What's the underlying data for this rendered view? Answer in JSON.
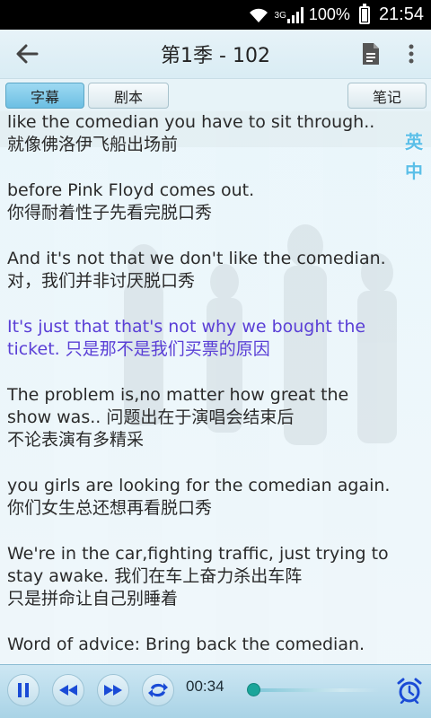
{
  "status_bar": {
    "network": "3G",
    "battery_text": "100%",
    "time": "21:54"
  },
  "header": {
    "title": "第1季 - 102",
    "back_icon": "arrow-left-icon",
    "doc_icon": "document-icon",
    "menu_icon": "overflow-menu-icon"
  },
  "tabs": [
    {
      "label": "字幕",
      "active": true
    },
    {
      "label": "剧本",
      "active": false
    },
    {
      "label": "笔记",
      "active": false
    }
  ],
  "lang_toggle": [
    "英",
    "中"
  ],
  "subtitles": [
    {
      "en": "like the comedian you have to sit through..",
      "zh": "就像佛洛伊飞船出场前",
      "current": false
    },
    {
      "en": "before Pink Floyd comes out.",
      "zh": "你得耐着性子先看完脱口秀",
      "current": false
    },
    {
      "en": "And it's not that we don't like the comedian.",
      "zh": "对，我们并非讨厌脱口秀",
      "current": false
    },
    {
      "en": "It's just that that's not why we bought the ticket.",
      "zh": "只是那不是我们买票的原因",
      "current": true
    },
    {
      "en": "The problem is,no matter how great the show was..",
      "zh": "问题出在于演唱会结束后\n不论表演有多精采",
      "current": false
    },
    {
      "en": "you girls are looking for the comedian again.",
      "zh": "你们女生总还想再看脱口秀",
      "current": false
    },
    {
      "en": "We're in the car,fighting traffic, just trying to stay awake.",
      "zh": "我们在车上奋力杀出车阵\n只是拼命让自己别睡着",
      "current": false
    },
    {
      "en": "Word of advice: Bring back the comedian.",
      "zh": "",
      "current": false
    }
  ],
  "player": {
    "time": "00:34",
    "progress": 0.05,
    "colors": {
      "accent": "#1aa59a",
      "icon": "#1a4bd6"
    }
  }
}
